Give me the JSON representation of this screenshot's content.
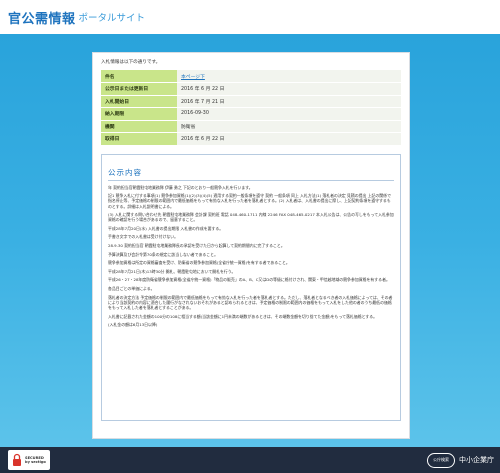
{
  "header": {
    "title_main": "官公需情報",
    "title_sub": "ポータルサイト"
  },
  "detail": {
    "intro": "入札情報は以下の通りです。",
    "rows": [
      {
        "label": "件名",
        "value": "本ページ下"
      },
      {
        "label": "公示日または更新日",
        "value": "2016 年 6 月 22 日"
      },
      {
        "label": "入札開始日",
        "value": "2016 年 7 月 21 日"
      },
      {
        "label": "納入期限",
        "value": "2016-09-30"
      },
      {
        "label": "機関",
        "value": "防衛省"
      },
      {
        "label": "取得日",
        "value": "2016 年 6 月 22 日"
      }
    ]
  },
  "notice": {
    "title": "公示内容",
    "paragraphs": [
      "年 契約担当官朝霞駐屯地業務隊 伊藤 勇之 下記のとおり一般競争入札を行います。",
      "記1 競争入札に付する事項(1) 競争参加資格(1)(2)(3)(4)(5) 適用する契約一般条項を遵守 契約 一般条項 同上 入札方法(1) 落札者の決定 見積の提出 上記の関係で指名停止等、予定価格の制限の範囲内で最低価格をもって有効な入札を行った者を落札者とする。(2) 入札者は、入札書の提出に際し、上記契約条項を遵守するものとする。詳細は入札説明書による。",
      "(3) 入札に関する問い合わせ先 朝霞駐屯地業務隊 会計課 契約班 電話 048-460-1711 内線 2246 FAX 048-465-0217 本入札公告は、公告の写しをもって入札参加資格の確認を行う場合があるので、留意すること。",
      "平成28年7月20日(水) 入札書の提出期限 入札書の作成を要する。",
      "手書き文字での入札書は受け付けない。",
      "28.9.30 契約担当官 朝霞駐屯地業務隊長の承認を受けた日から起算して契約期間内に完了すること。",
      "予算決算及び会計令第70条の規定に該当しない者であること。",
      "競争参加資格は所定の資格審査を受け、防衛省の競争参加資格(全省庁統一資格)を有する者であること。",
      "平成28年7月21日(木)13時30分 開札、朝霞駐屯地において開札を行う。",
      "平成26・27・28年度防衛省競争参加資格(全省庁統一資格)「物品の販売」のA、B、C又はDの等級に格付けされ、関東・甲信越地域の競争参加資格を有する者。",
      "各品目ごとの単価による。",
      "落札者の決定方法 予定価格の制限の範囲内で最低価格をもって有効な入札を行った者を落札者とする。ただし、落札者となるべき者の入札価格によっては、その者により当該契約の内容に適合した履行がなされないおそれがあると認められるときは、予定価格の制限の範囲内の価格をもって入札をした他の者のうち最低の価格をもって入札した者を落札者とすることがある。",
      "入札書に記載された金額の100分の108に相当する額(当該金額に1円未満の端数があるときは、その端数金額を切り捨てた金額)をもって落札価格とする。",
      "(入札金の額は6月13日以降)"
    ]
  },
  "footer": {
    "secured_line1": "SECURED",
    "secured_line2": "by sectigo",
    "badge": "公庁検索",
    "agency": "中小企業庁"
  }
}
